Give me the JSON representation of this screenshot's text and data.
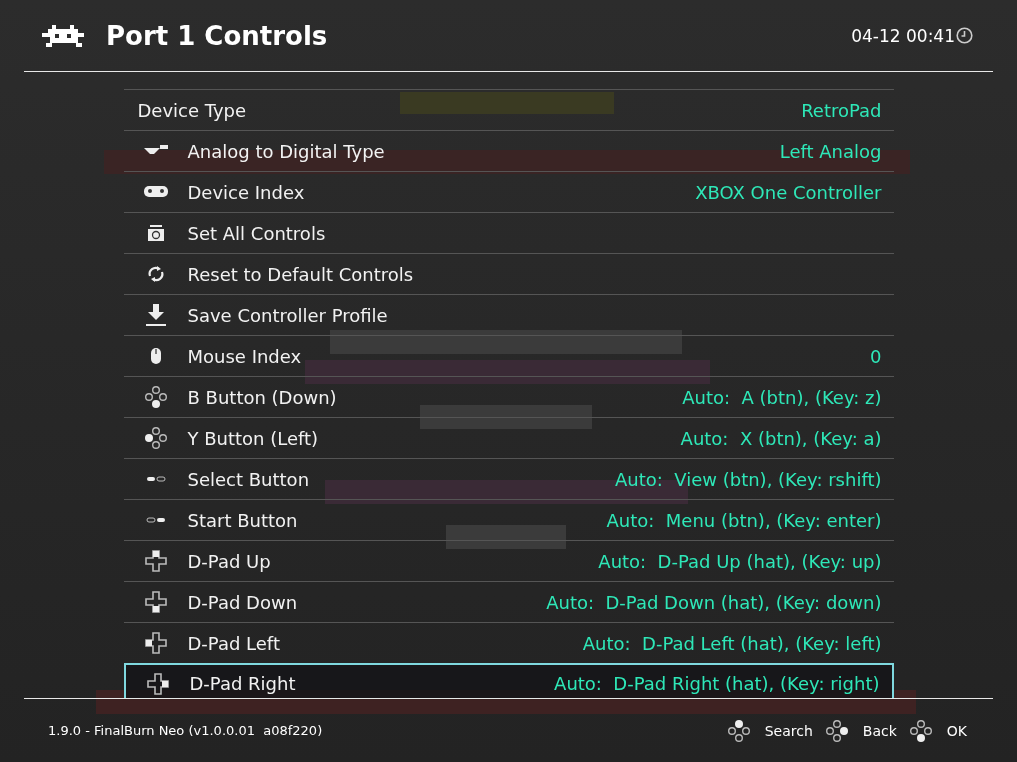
{
  "header": {
    "title": "Port 1 Controls",
    "clock": "04-12 00:41"
  },
  "rows": [
    {
      "kind": "none",
      "label": "Device Type",
      "value": "RetroPad",
      "selected": false
    },
    {
      "kind": "analog",
      "label": "Analog to Digital Type",
      "value": "Left Analog",
      "selected": false
    },
    {
      "kind": "gamepad",
      "label": "Device Index",
      "value": "XBOX One Controller",
      "selected": false
    },
    {
      "kind": "set-all",
      "label": "Set All Controls",
      "selected": false
    },
    {
      "kind": "reset",
      "label": "Reset to Default Controls",
      "selected": false
    },
    {
      "kind": "save",
      "label": "Save Controller Profile",
      "selected": false
    },
    {
      "kind": "mouse",
      "label": "Mouse Index",
      "value": "0",
      "selected": false
    },
    {
      "kind": "face-down",
      "label": "B Button (Down)",
      "value": "Auto:  A (btn), (Key: z)",
      "selected": false
    },
    {
      "kind": "face-left",
      "label": "Y Button (Left)",
      "value": "Auto:  X (btn), (Key: a)",
      "selected": false
    },
    {
      "kind": "select",
      "label": "Select Button",
      "value": "Auto:  View (btn), (Key: rshift)",
      "selected": false
    },
    {
      "kind": "start",
      "label": "Start Button",
      "value": "Auto:  Menu (btn), (Key: enter)",
      "selected": false
    },
    {
      "kind": "dpad-up",
      "label": "D-Pad Up",
      "value": "Auto:  D-Pad Up (hat), (Key: up)",
      "selected": false
    },
    {
      "kind": "dpad-down",
      "label": "D-Pad Down",
      "value": "Auto:  D-Pad Down (hat), (Key: down)",
      "selected": false
    },
    {
      "kind": "dpad-left",
      "label": "D-Pad Left",
      "value": "Auto:  D-Pad Left (hat), (Key: left)",
      "selected": false
    },
    {
      "kind": "dpad-right",
      "label": "D-Pad Right",
      "value": "Auto:  D-Pad Right (hat), (Key: right)",
      "selected": true
    }
  ],
  "footer": {
    "version": "1.9.0 - FinalBurn Neo (v1.0.0.01  a08f220)",
    "hints": [
      {
        "kind": "face-up",
        "label": "Search"
      },
      {
        "kind": "face-right",
        "label": "Back"
      },
      {
        "kind": "face-down",
        "label": "OK"
      }
    ]
  }
}
